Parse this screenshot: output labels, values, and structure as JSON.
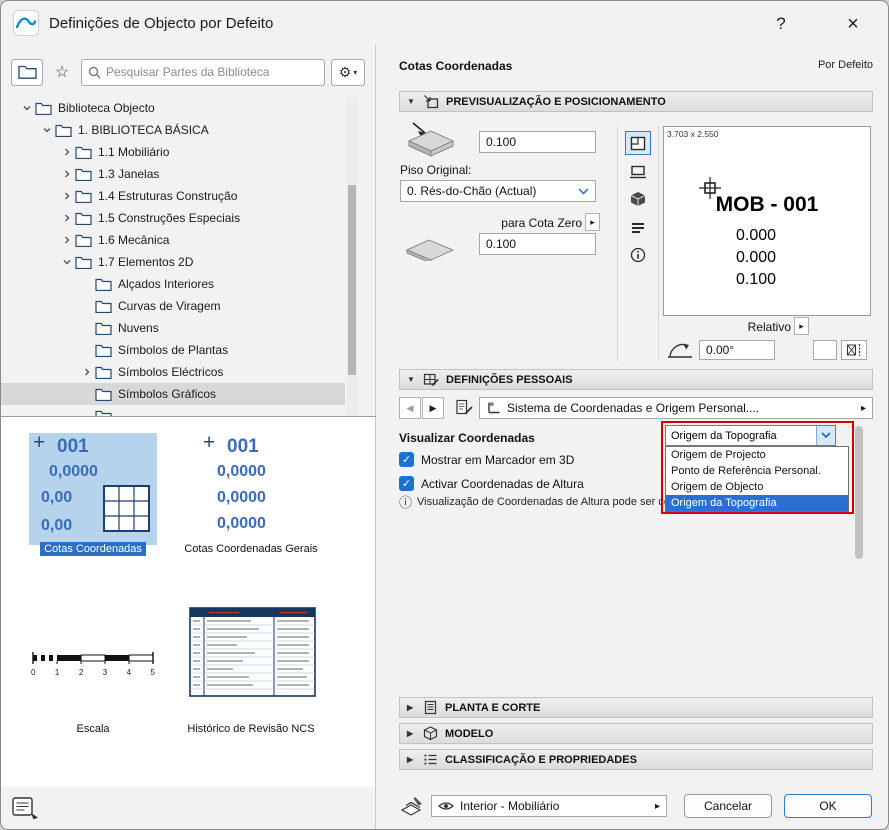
{
  "window": {
    "title": "Definições de Objecto por Defeito",
    "help_label": "?",
    "close_label": "×"
  },
  "icons": {
    "tri_down": "▼",
    "tri_right": "▶",
    "arrow_left": "◀",
    "arrow_right": "▶",
    "flyout": "▸",
    "gear": "⚙",
    "gear_caret": "▾",
    "star": "☆",
    "info": "ⓘ",
    "check": "✓"
  },
  "library": {
    "search_placeholder": "Pesquisar Partes da Biblioteca",
    "tree": [
      {
        "label": "Biblioteca Objecto",
        "level": 0,
        "expander": "expanded",
        "selected": false
      },
      {
        "label": "1. BIBLIOTECA BÁSICA",
        "level": 1,
        "expander": "expanded",
        "selected": false
      },
      {
        "label": "1.1 Mobiliário",
        "level": 2,
        "expander": "collapsed",
        "selected": false
      },
      {
        "label": "1.3 Janelas",
        "level": 2,
        "expander": "collapsed",
        "selected": false
      },
      {
        "label": "1.4 Estruturas Construção",
        "level": 2,
        "expander": "collapsed",
        "selected": false
      },
      {
        "label": "1.5 Construções Especiais",
        "level": 2,
        "expander": "collapsed",
        "selected": false
      },
      {
        "label": "1.6 Mecânica",
        "level": 2,
        "expander": "collapsed",
        "selected": false
      },
      {
        "label": "1.7 Elementos 2D",
        "level": 2,
        "expander": "expanded",
        "selected": false
      },
      {
        "label": "Alçados Interiores",
        "level": 3,
        "expander": "none",
        "selected": false
      },
      {
        "label": "Curvas de Viragem",
        "level": 3,
        "expander": "none",
        "selected": false
      },
      {
        "label": "Nuvens",
        "level": 3,
        "expander": "none",
        "selected": false
      },
      {
        "label": "Símbolos de Plantas",
        "level": 3,
        "expander": "none",
        "selected": false
      },
      {
        "label": "Símbolos Eléctricos",
        "level": 3,
        "expander": "collapsed",
        "selected": false
      },
      {
        "label": "Símbolos Gráficos",
        "level": 3,
        "expander": "none",
        "selected": true
      },
      {
        "label": "",
        "level": 3,
        "expander": "none",
        "selected": false
      }
    ],
    "thumbnails": {
      "item1": {
        "label": "Cotas Coordenadas",
        "marker": "+",
        "lines": [
          "001",
          "0,0000",
          "0,00",
          "0,00"
        ]
      },
      "item2": {
        "label": "Cotas Coordenadas Gerais",
        "marker": "+",
        "lines": [
          "001",
          "0,0000",
          "0,0000",
          "0,0000"
        ]
      },
      "item3": {
        "label": "Escala",
        "ticks": [
          "0",
          "1",
          "2",
          "3",
          "4",
          "5"
        ]
      },
      "item4": {
        "label": "Histórico de Revisão NCS"
      }
    }
  },
  "settings": {
    "part_name": "Cotas Coordenadas",
    "default_label": "Por Defeito",
    "preview_section": {
      "title": "PREVISUALIZAÇÃO E POSICIONAMENTO",
      "offset_top": "0.100",
      "floor_label": "Piso Original:",
      "floor_value": "0. Rés-do-Chão (Actual)",
      "to_zero_label": "para Cota Zero",
      "offset_bottom": "0.100",
      "preview_size": "3.703 x 2.550",
      "preview_title": "MOB - 001",
      "preview_lines": [
        "0.000",
        "0.000",
        "0.100"
      ],
      "relative_label": "Relativo",
      "rotation_value": "0.00°"
    },
    "personal_section": {
      "title": "DEFINIÇÕES PESSOAIS",
      "page_selector": "Sistema de Coordenadas e Origem Personal....",
      "visualize_label": "Visualizar Coordenadas",
      "origin_value": "Origem da Topografia",
      "origin_options": [
        "Origem de Projecto",
        "Ponto de Referência Personal.",
        "Origem de Objecto",
        "Origem da Topografia"
      ],
      "checkbox_marker_3d": "Mostrar em Marcador em 3D",
      "checkbox_height": "Activar Coordenadas de Altura",
      "info_text": "Visualização de Coordenadas de Altura pode ser controlada separadamente em 2..."
    },
    "collapsed_sections": {
      "plan": "PLANTA E CORTE",
      "model": "MODELO",
      "classification": "CLASSIFICAÇÃO E PROPRIEDADES"
    },
    "footer": {
      "layer_value": "Interior - Mobiliário",
      "cancel_label": "Cancelar",
      "ok_label": "OK"
    }
  },
  "colors": {
    "accent": "#2b7cd3",
    "selection": "#2a6fc2",
    "highlight_red": "#d60000",
    "thumb_blue_bg": "#b5d3ec",
    "thumb_text": "#3a6db8"
  }
}
